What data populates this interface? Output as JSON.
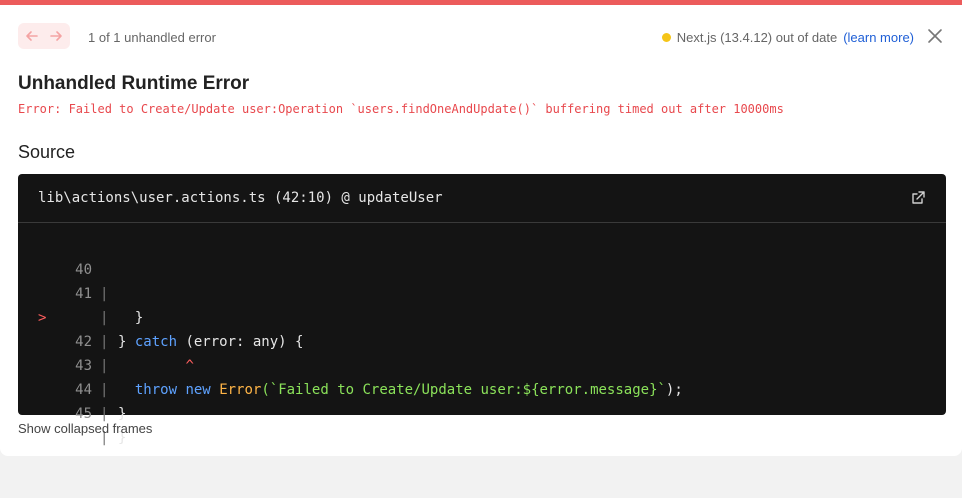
{
  "nav": {
    "counter": "1 of 1 unhandled error"
  },
  "version": {
    "label": "Next.js (13.4.12) out of date",
    "link": "(learn more)",
    "status_color": "#f5c518"
  },
  "error": {
    "title": "Unhandled Runtime Error",
    "message": "Error: Failed to Create/Update user:Operation `users.findOneAndUpdate()` buffering timed out after 10000ms"
  },
  "source": {
    "heading": "Source",
    "file": "lib\\actions\\user.actions.ts (42:10) @ updateUser",
    "lines": {
      "l40": {
        "no": "40",
        "code": "  }"
      },
      "l41": {
        "no": "41",
        "code_a": "} ",
        "kw": "catch",
        "code_b": " (error: any) {"
      },
      "l42": {
        "no": "42",
        "marker": ">",
        "kw1": "throw",
        "kw2": "new",
        "fn": "Error",
        "str": "(`Failed to Create/Update user:${error.message}`",
        "end": ");"
      },
      "caret": {
        "symbol": "^"
      },
      "l43": {
        "no": "43",
        "code": "}"
      },
      "l44": {
        "no": "44",
        "code": "}"
      },
      "l45": {
        "no": "45",
        "code": ""
      }
    }
  },
  "footer": {
    "show_collapsed": "Show collapsed frames"
  },
  "colors": {
    "accent": "#ec5b5b",
    "error_text": "#e8484d",
    "code_bg": "#141414"
  }
}
